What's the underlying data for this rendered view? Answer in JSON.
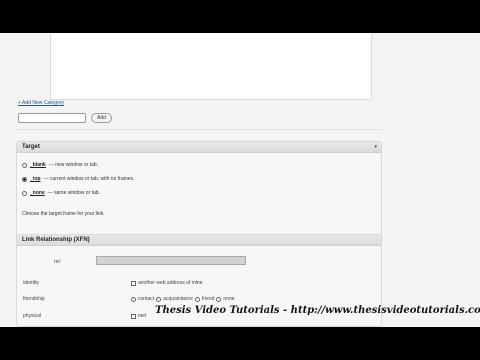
{
  "categories": {
    "add_link": "+ Add New Category",
    "add_input_value": "",
    "add_button": "Add"
  },
  "target": {
    "title": "Target",
    "toggle": "▾",
    "options": [
      {
        "label": "_blank",
        "desc": "— new window or tab.",
        "checked": false
      },
      {
        "label": "_top",
        "desc": "— current window or tab, with no frames.",
        "checked": true
      },
      {
        "label": "_none",
        "desc": "— same window or tab.",
        "checked": false
      }
    ],
    "choose_text": "Choose the target frame for your link."
  },
  "xfn": {
    "title": "Link Relationship (XFN)",
    "rel_label": "rel:",
    "rel_value": "",
    "rows": {
      "identity": {
        "label": "identity",
        "option": "another web address of mine"
      },
      "friendship": {
        "label": "friendship",
        "options": [
          "contact",
          "acquaintance",
          "friend",
          "none"
        ]
      },
      "physical": {
        "label": "physical",
        "option": "met"
      }
    }
  },
  "watermark": "Thesis Video Tutorials -   http://www.thesisvideotutorials.com"
}
